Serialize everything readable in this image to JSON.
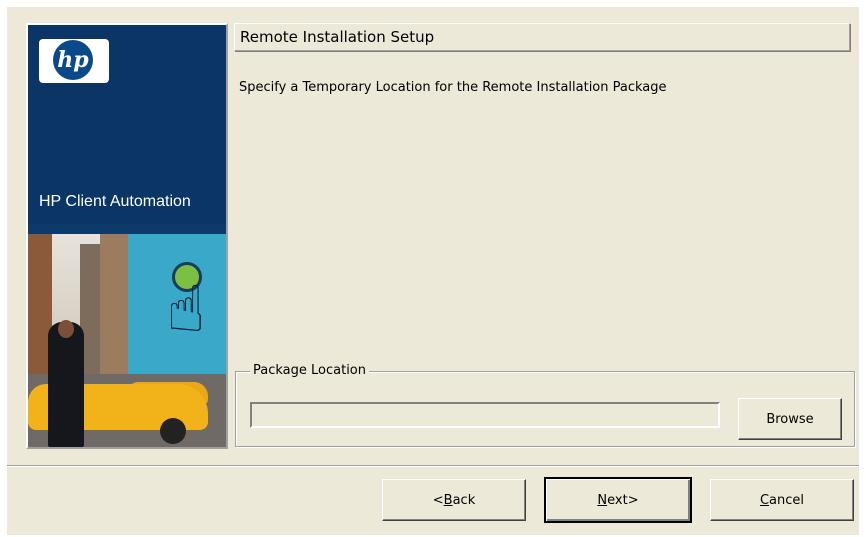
{
  "banner": {
    "logo_text": "hp",
    "product_name": "HP Client Automation"
  },
  "header": {
    "title": "Remote Installation Setup",
    "subtitle": "Specify a Temporary Location for the Remote Installation Package"
  },
  "package_location": {
    "legend": "Package Location",
    "value": "",
    "browse_label": "Browse"
  },
  "buttons": {
    "back": {
      "mnemonic": "B",
      "rest": "ack",
      "prefix": "<"
    },
    "next": {
      "mnemonic": "N",
      "rest": "ext",
      "suffix": ">"
    },
    "cancel": {
      "mnemonic": "C",
      "rest": "ancel"
    }
  },
  "colors": {
    "dialog_bg": "#ece9d8",
    "banner_blue": "#0b3565"
  }
}
